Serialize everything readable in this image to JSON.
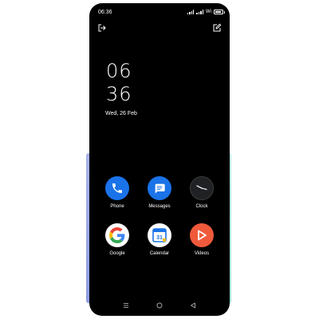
{
  "status_bar": {
    "time": "06:36",
    "wifi_label": "Wi",
    "battery_level": 0.85
  },
  "top_actions": {
    "exit_icon": "exit-icon",
    "edit_icon": "edit-icon"
  },
  "lock_clock": {
    "hour": "06",
    "minute": "36",
    "date": "Wed, 26 Feb"
  },
  "apps": [
    {
      "label": "Phone",
      "icon": "phone-icon",
      "color": "#1a73e8"
    },
    {
      "label": "Messages",
      "icon": "messages-icon",
      "color": "#1a73e8"
    },
    {
      "label": "Clock",
      "icon": "clock-icon",
      "color": "#202124"
    },
    {
      "label": "Google",
      "icon": "google-icon",
      "color": "#ffffff"
    },
    {
      "label": "Calendar",
      "icon": "calendar-icon",
      "color": "#ffffff",
      "calendar_day": "31"
    },
    {
      "label": "Videos",
      "icon": "videos-icon",
      "color": "#f05a3c"
    }
  ],
  "nav_bar": {
    "recents_icon": "recents-icon",
    "home_icon": "home-icon",
    "back_icon": "back-icon"
  }
}
